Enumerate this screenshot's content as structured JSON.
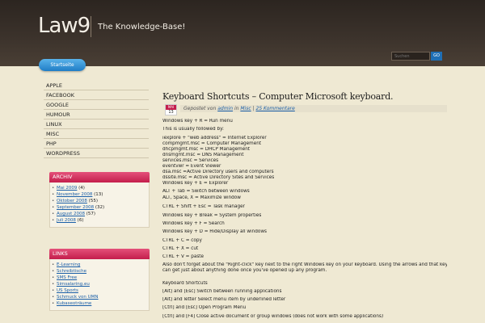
{
  "header": {
    "logo": "Law9",
    "tagline": "The Knowledge-Base!",
    "search_placeholder": "Suchen",
    "search_button": "GO"
  },
  "nav": {
    "home": "Startseite"
  },
  "sidebar": {
    "menu": [
      "APPLE",
      "FACEBOOK",
      "GOOGLE",
      "HUMOUR",
      "LINUX",
      "MISC",
      "PHP",
      "WORDPRESS"
    ],
    "archive": {
      "title": "ARCHIV",
      "items": [
        {
          "label": "Mai 2009",
          "count": "(4)"
        },
        {
          "label": "November 2008",
          "count": "(13)"
        },
        {
          "label": "Oktober 2008",
          "count": "(55)"
        },
        {
          "label": "September 2008",
          "count": "(32)"
        },
        {
          "label": "August 2008",
          "count": "(57)"
        },
        {
          "label": "Juli 2008",
          "count": "(6)"
        }
      ]
    },
    "links": {
      "title": "LINKS",
      "items": [
        "E-Learning",
        "Schreibtische",
        "SMS Free",
        "Simsalaring.eu",
        "US Sports",
        "Schmuck von UMN",
        "Kubaseoträume"
      ]
    }
  },
  "post": {
    "title": "Keyboard Shortcuts – Computer Microsoft keyboard.",
    "date_month": "MAI",
    "date_day": "13",
    "meta_prefix": "Gepostet von",
    "author": "admin",
    "meta_in": "in",
    "category": "Misc",
    "separator": "|",
    "comments": "25 Kommentare",
    "lines": [
      " Windows key + R = Run menu",
      "This is usually followed by:",
      "iexplore + \"web address\" = Internet Explorer",
      "compmgmt.msc = Computer Management",
      "dhcpmgmt.msc = DHCP Management",
      "dnsmgmt.msc = DNS Management",
      "services.msc = Services",
      "eventvwr = Event Viewer",
      "dsa.msc =Active Directory users and computers",
      "dssite.msc = Active Directory Sites and Services",
      "Windows key + E = Explorer",
      "ALT + Tab = Switch between windows",
      "ALT, Space, X = Maximize window",
      "CTRL + Shift + Esc = Task manager",
      "Windows key + Break = System properties",
      "Windows key + F = Search",
      "Windows key + D = Hide/Display all windows",
      "CTRL + C = copy",
      "CTRL + X = cut",
      "CTRL + V = paste",
      "Also don't forget about the \"Right-click\" key next to the right Windows key on your keyboard. Using the arrows and that key",
      "can get just about anything done once you've opened up any program.",
      "Keyboard Shortcuts",
      "[Alt] and [Esc] Switch between running applications",
      "[Alt] and letter Select menu item by underlined letter",
      "[Ctrl] and [Esc] Open Program Menu",
      "[Ctrl] and [F4] Close active document or group windows (does not work with some applications)"
    ]
  }
}
